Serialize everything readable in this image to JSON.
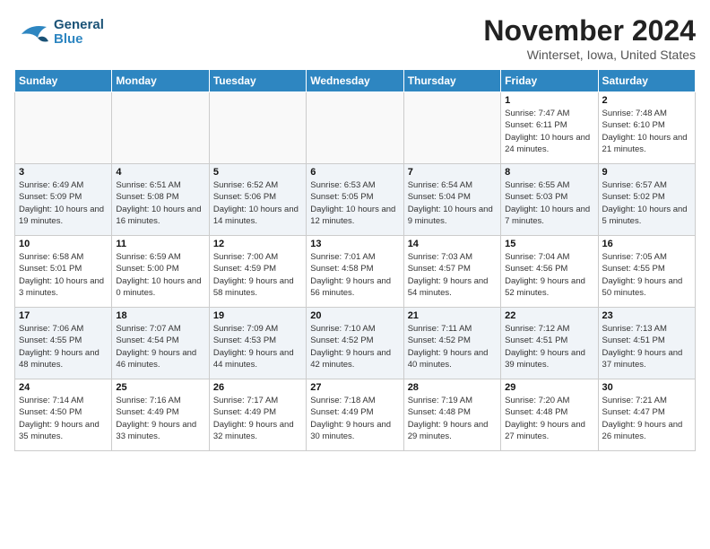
{
  "header": {
    "logo_general": "General",
    "logo_blue": "Blue",
    "month_title": "November 2024",
    "location": "Winterset, Iowa, United States"
  },
  "weekdays": [
    "Sunday",
    "Monday",
    "Tuesday",
    "Wednesday",
    "Thursday",
    "Friday",
    "Saturday"
  ],
  "weeks": [
    [
      {
        "day": "",
        "info": ""
      },
      {
        "day": "",
        "info": ""
      },
      {
        "day": "",
        "info": ""
      },
      {
        "day": "",
        "info": ""
      },
      {
        "day": "",
        "info": ""
      },
      {
        "day": "1",
        "info": "Sunrise: 7:47 AM\nSunset: 6:11 PM\nDaylight: 10 hours\nand 24 minutes."
      },
      {
        "day": "2",
        "info": "Sunrise: 7:48 AM\nSunset: 6:10 PM\nDaylight: 10 hours\nand 21 minutes."
      }
    ],
    [
      {
        "day": "3",
        "info": "Sunrise: 6:49 AM\nSunset: 5:09 PM\nDaylight: 10 hours\nand 19 minutes."
      },
      {
        "day": "4",
        "info": "Sunrise: 6:51 AM\nSunset: 5:08 PM\nDaylight: 10 hours\nand 16 minutes."
      },
      {
        "day": "5",
        "info": "Sunrise: 6:52 AM\nSunset: 5:06 PM\nDaylight: 10 hours\nand 14 minutes."
      },
      {
        "day": "6",
        "info": "Sunrise: 6:53 AM\nSunset: 5:05 PM\nDaylight: 10 hours\nand 12 minutes."
      },
      {
        "day": "7",
        "info": "Sunrise: 6:54 AM\nSunset: 5:04 PM\nDaylight: 10 hours\nand 9 minutes."
      },
      {
        "day": "8",
        "info": "Sunrise: 6:55 AM\nSunset: 5:03 PM\nDaylight: 10 hours\nand 7 minutes."
      },
      {
        "day": "9",
        "info": "Sunrise: 6:57 AM\nSunset: 5:02 PM\nDaylight: 10 hours\nand 5 minutes."
      }
    ],
    [
      {
        "day": "10",
        "info": "Sunrise: 6:58 AM\nSunset: 5:01 PM\nDaylight: 10 hours\nand 3 minutes."
      },
      {
        "day": "11",
        "info": "Sunrise: 6:59 AM\nSunset: 5:00 PM\nDaylight: 10 hours\nand 0 minutes."
      },
      {
        "day": "12",
        "info": "Sunrise: 7:00 AM\nSunset: 4:59 PM\nDaylight: 9 hours\nand 58 minutes."
      },
      {
        "day": "13",
        "info": "Sunrise: 7:01 AM\nSunset: 4:58 PM\nDaylight: 9 hours\nand 56 minutes."
      },
      {
        "day": "14",
        "info": "Sunrise: 7:03 AM\nSunset: 4:57 PM\nDaylight: 9 hours\nand 54 minutes."
      },
      {
        "day": "15",
        "info": "Sunrise: 7:04 AM\nSunset: 4:56 PM\nDaylight: 9 hours\nand 52 minutes."
      },
      {
        "day": "16",
        "info": "Sunrise: 7:05 AM\nSunset: 4:55 PM\nDaylight: 9 hours\nand 50 minutes."
      }
    ],
    [
      {
        "day": "17",
        "info": "Sunrise: 7:06 AM\nSunset: 4:55 PM\nDaylight: 9 hours\nand 48 minutes."
      },
      {
        "day": "18",
        "info": "Sunrise: 7:07 AM\nSunset: 4:54 PM\nDaylight: 9 hours\nand 46 minutes."
      },
      {
        "day": "19",
        "info": "Sunrise: 7:09 AM\nSunset: 4:53 PM\nDaylight: 9 hours\nand 44 minutes."
      },
      {
        "day": "20",
        "info": "Sunrise: 7:10 AM\nSunset: 4:52 PM\nDaylight: 9 hours\nand 42 minutes."
      },
      {
        "day": "21",
        "info": "Sunrise: 7:11 AM\nSunset: 4:52 PM\nDaylight: 9 hours\nand 40 minutes."
      },
      {
        "day": "22",
        "info": "Sunrise: 7:12 AM\nSunset: 4:51 PM\nDaylight: 9 hours\nand 39 minutes."
      },
      {
        "day": "23",
        "info": "Sunrise: 7:13 AM\nSunset: 4:51 PM\nDaylight: 9 hours\nand 37 minutes."
      }
    ],
    [
      {
        "day": "24",
        "info": "Sunrise: 7:14 AM\nSunset: 4:50 PM\nDaylight: 9 hours\nand 35 minutes."
      },
      {
        "day": "25",
        "info": "Sunrise: 7:16 AM\nSunset: 4:49 PM\nDaylight: 9 hours\nand 33 minutes."
      },
      {
        "day": "26",
        "info": "Sunrise: 7:17 AM\nSunset: 4:49 PM\nDaylight: 9 hours\nand 32 minutes."
      },
      {
        "day": "27",
        "info": "Sunrise: 7:18 AM\nSunset: 4:49 PM\nDaylight: 9 hours\nand 30 minutes."
      },
      {
        "day": "28",
        "info": "Sunrise: 7:19 AM\nSunset: 4:48 PM\nDaylight: 9 hours\nand 29 minutes."
      },
      {
        "day": "29",
        "info": "Sunrise: 7:20 AM\nSunset: 4:48 PM\nDaylight: 9 hours\nand 27 minutes."
      },
      {
        "day": "30",
        "info": "Sunrise: 7:21 AM\nSunset: 4:47 PM\nDaylight: 9 hours\nand 26 minutes."
      }
    ]
  ]
}
